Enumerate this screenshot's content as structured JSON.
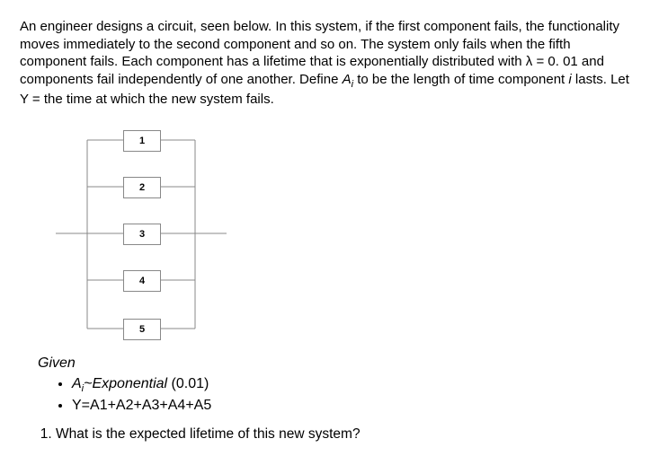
{
  "problem": {
    "text_pre": "An engineer designs a circuit, seen below. In this system, if the first component fails, the functionality moves immediately to the second component and so on. The system only fails when the fifth component fails. Each component has a lifetime that is exponentially distributed with λ = 0. 01 and components fail independently of one another. Define ",
    "var_a": "A",
    "var_a_sub": "i",
    "text_mid": " to be the length of time component ",
    "var_i": "i",
    "text_post": " lasts. Let Y = the time at which the new system fails."
  },
  "circuit": {
    "labels": [
      "1",
      "2",
      "3",
      "4",
      "5"
    ]
  },
  "given": {
    "heading": "Given",
    "item1_pre": "A",
    "item1_sub": "i",
    "item1_post": "~Exponential",
    "item1_param": " (0.01)",
    "item2": "Y=A1+A2+A3+A4+A5"
  },
  "question": {
    "q1": "What is the expected lifetime of this new system?"
  }
}
